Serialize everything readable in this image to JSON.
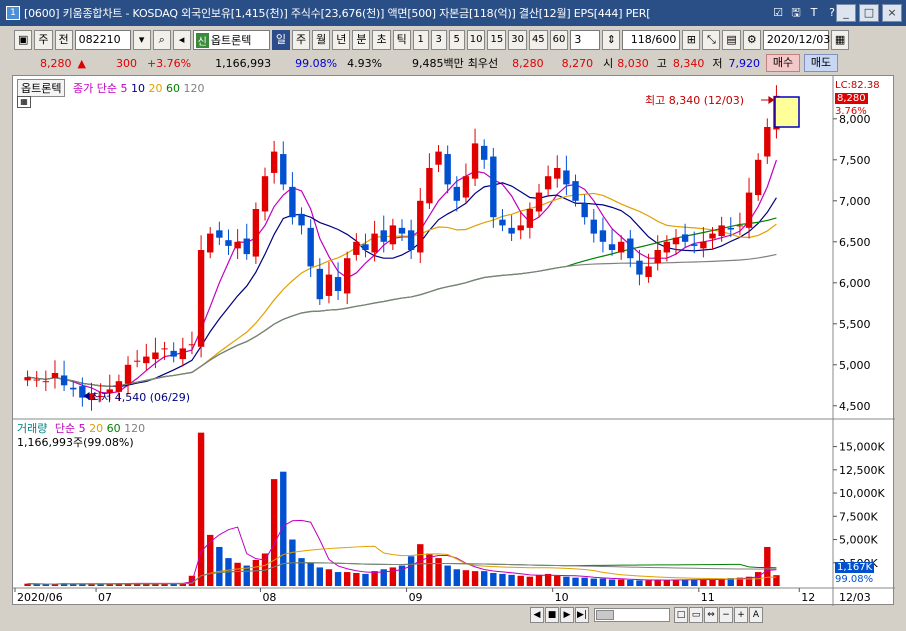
{
  "window": {
    "title": "[0600] 키움종합차트 - KOSDAQ 외국인보유[1,415(천)] 주식수[23,676(천)] 액면[500] 자본금[118(억)] 결산[12월] EPS[444] PER[",
    "number_icon": "1",
    "title_buttons": [
      "☑",
      "🖫",
      "T",
      "?",
      "-"
    ],
    "win_buttons": [
      "_",
      "□",
      "×"
    ]
  },
  "toolbar": {
    "period_label": "주",
    "prev_label": "전",
    "stock_code": "082210",
    "stock_tag": "신",
    "stock_name": "옵트론텍",
    "periods": [
      "일",
      "주",
      "월",
      "년",
      "분",
      "초",
      "틱"
    ],
    "numbers": [
      "1",
      "3",
      "5",
      "10",
      "15",
      "30",
      "45",
      "60"
    ],
    "interval_value": "3",
    "count": "118/600",
    "date": "2020/12/03"
  },
  "infobar": {
    "price": "8,280",
    "change_arrow": "▲",
    "change": "300",
    "change_pct": "+3.76%",
    "volume": "1,166,993",
    "vol_ratio": "99.08%",
    "turnover": "4.93%",
    "amount": "9,485백만",
    "best_label": "최우선",
    "bid": "8,280",
    "ask": "8,270",
    "open_label": "시",
    "open": "8,030",
    "high_label": "고",
    "high": "8,340",
    "low_label": "저",
    "low": "7,920",
    "buy_label": "매수",
    "sell_label": "매도"
  },
  "price_panel": {
    "stock_label": "옵트론텍",
    "ma_label": "종가 단순",
    "ma_periods": [
      "5",
      "10",
      "20",
      "60",
      "120"
    ],
    "ma_colors": [
      "#c000c0",
      "#000080",
      "#e0a000",
      "#008000",
      "#808080"
    ],
    "lc_label": "LC:82.38",
    "last_price_label": "8,280",
    "last_pct_label": "3.76%",
    "high_annot": "최고 8,340 (12/03)",
    "low_annot": "최저 4,540 (06/29)",
    "y_ticks": [
      "8,000",
      "7,500",
      "7,000",
      "6,500",
      "6,000",
      "5,500",
      "5,000",
      "4,500"
    ]
  },
  "volume_panel": {
    "label": "거래량",
    "ma_label": "단순",
    "ma_periods": [
      "5",
      "20",
      "60",
      "120"
    ],
    "ma_colors": [
      "#c000c0",
      "#e0a000",
      "#008000",
      "#808080"
    ],
    "current": "1,166,993주(99.08%)",
    "last_vol_label": "1,167K",
    "last_vol_pct": "99.08%",
    "y_ticks": [
      "15,000K",
      "12,500K",
      "10,000K",
      "7,500K",
      "5,000K",
      "2,500K"
    ]
  },
  "x_axis": {
    "labels": [
      "2020/06",
      "07",
      "08",
      "09",
      "10",
      "11",
      "12",
      "12/03"
    ]
  },
  "colors": {
    "up": "#e00000",
    "down": "#0050d0",
    "accent": "#2a4f86"
  },
  "chart_data": {
    "type": "candlestick",
    "ohlc_close_approx": [
      4850,
      4820,
      4800,
      4900,
      4750,
      4700,
      4600,
      4650,
      4620,
      4700,
      4800,
      5000,
      5050,
      5100,
      5150,
      5200,
      5100,
      5200,
      5250,
      6400,
      6600,
      6550,
      6450,
      6500,
      6350,
      6900,
      7300,
      7600,
      7200,
      6800,
      6700,
      6200,
      5800,
      6100,
      5900,
      6300,
      6500,
      6400,
      6600,
      6500,
      6700,
      6600,
      6400,
      7000,
      7400,
      7600,
      7200,
      7000,
      7300,
      7700,
      7500,
      6800,
      6700,
      6600,
      6700,
      6900,
      7100,
      7300,
      7400,
      7200,
      7000,
      6800,
      6600,
      6500,
      6400,
      6500,
      6300,
      6100,
      6200,
      6400,
      6500,
      6550,
      6500,
      6450,
      6500,
      6600,
      6700,
      6650,
      6700,
      7100,
      7500,
      7900,
      8280
    ],
    "volume_thousands_approx": [
      250,
      200,
      180,
      220,
      300,
      260,
      200,
      180,
      240,
      280,
      320,
      300,
      260,
      240,
      280,
      320,
      300,
      260,
      1100,
      16500,
      5500,
      4200,
      3000,
      2500,
      2200,
      2800,
      3500,
      11500,
      12300,
      5000,
      3000,
      2500,
      2000,
      1800,
      1500,
      1500,
      1400,
      1300,
      1600,
      1800,
      2000,
      2200,
      3200,
      4500,
      3500,
      3000,
      2200,
      1800,
      1700,
      1600,
      1600,
      1400,
      1300,
      1200,
      1100,
      1000,
      1200,
      1300,
      1100,
      1000,
      900,
      900,
      800,
      800,
      700,
      700,
      650,
      600,
      600,
      650,
      650,
      700,
      700,
      650,
      700,
      700,
      800,
      850,
      900,
      1000,
      1500,
      4200,
      1167
    ],
    "ylim": [
      4400,
      8400
    ],
    "volume_ylim": [
      0,
      17000
    ]
  }
}
